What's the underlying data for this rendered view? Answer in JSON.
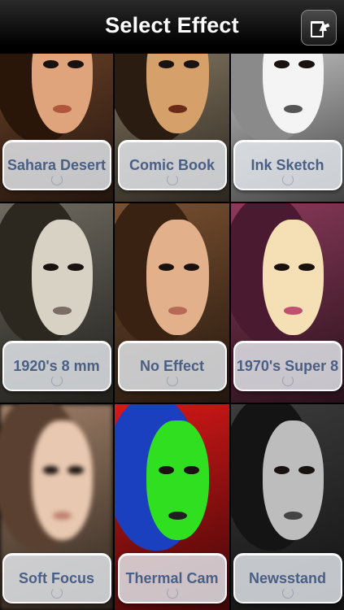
{
  "header": {
    "title": "Select Effect",
    "share_icon": "share-export-icon"
  },
  "effects": [
    {
      "label": "Sahara Desert",
      "bg": "#7a4a2e",
      "hair": "#2a1608",
      "face": "#e0a47c",
      "lips": "#b0563f"
    },
    {
      "label": "Comic Book",
      "bg": "#9a8a70",
      "hair": "#2a1c10",
      "face": "#d6a06a",
      "lips": "#6a2a18"
    },
    {
      "label": "Ink Sketch",
      "bg": "#e6e6e6",
      "hair": "#8a8a8a",
      "face": "#f4f4f4",
      "lips": "#555555"
    },
    {
      "label": "1920's 8 mm",
      "bg": "#6e6a60",
      "hair": "#2c2820",
      "face": "#d8d2c4",
      "lips": "#7a6e64"
    },
    {
      "label": "No Effect",
      "bg": "#7a5030",
      "hair": "#3a2212",
      "face": "#e2b08a",
      "lips": "#b86a58"
    },
    {
      "label": "1970's Super 8",
      "bg": "#8a3a5a",
      "hair": "#4a1a30",
      "face": "#f4e0b4",
      "lips": "#c05070"
    },
    {
      "label": "Soft Focus",
      "bg": "#a08068",
      "hair": "#5a4030",
      "face": "#e8c8b0",
      "lips": "#c08070"
    },
    {
      "label": "Thermal Cam",
      "bg": "#d81818",
      "hair": "#1a40c0",
      "face": "#30e020",
      "lips": "#202020"
    },
    {
      "label": "Newsstand",
      "bg": "#3c3c3c",
      "hair": "#141414",
      "face": "#bdbdbd",
      "lips": "#444444"
    }
  ]
}
